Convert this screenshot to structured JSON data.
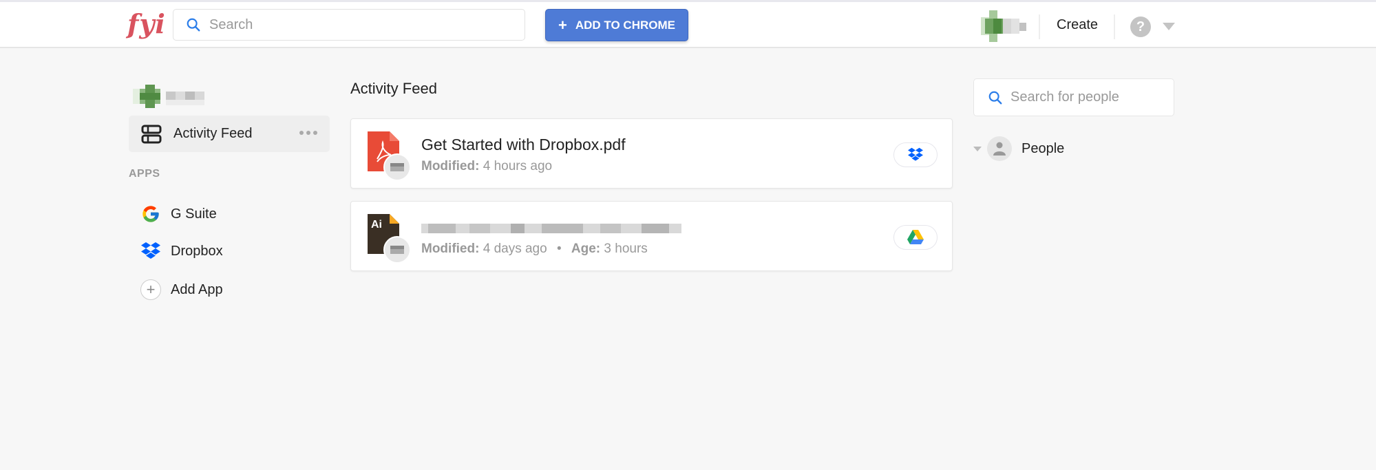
{
  "topbar": {
    "logo": "fyi",
    "search_placeholder": "Search",
    "add_to_chrome_label": "ADD TO CHROME",
    "create_label": "Create",
    "help_label": "?"
  },
  "sidebar": {
    "active_item": "Activity Feed",
    "apps_heading": "APPS",
    "apps": [
      {
        "label": "G Suite",
        "icon": "google-icon"
      },
      {
        "label": "Dropbox",
        "icon": "dropbox-icon"
      },
      {
        "label": "Add App",
        "icon": "plus-icon"
      }
    ]
  },
  "feed": {
    "title": "Activity Feed",
    "items": [
      {
        "name": "Get Started with Dropbox.pdf",
        "file_type": "pdf",
        "modified_label": "Modified:",
        "modified_value": "4 hours ago",
        "source": "dropbox"
      },
      {
        "name": "",
        "name_redacted": true,
        "file_type": "ai",
        "file_icon_text": "Ai",
        "modified_label": "Modified:",
        "modified_value": "4 days ago",
        "age_label": "Age:",
        "age_value": "3 hours",
        "source": "google-drive"
      }
    ]
  },
  "people_panel": {
    "search_placeholder": "Search for people",
    "group_label": "People"
  },
  "colors": {
    "brand": "#d9535f",
    "primary_button": "#4e7bd6",
    "dropbox": "#0061fe",
    "pdf": "#e84b37",
    "ai_bg": "#3a2f24",
    "ai_accent": "#f7a823"
  }
}
